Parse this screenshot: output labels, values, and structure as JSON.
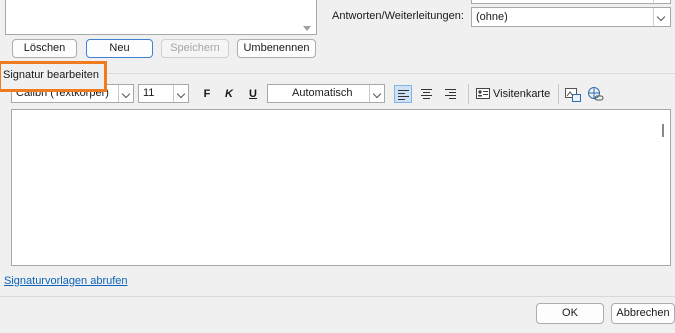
{
  "signature_buttons": {
    "delete": "Löschen",
    "new": "Neu",
    "save": "Speichern",
    "rename": "Umbenennen"
  },
  "replies_forwards": {
    "label": "Antworten/Weiterleitungen:",
    "value": "(ohne)"
  },
  "edit_section": {
    "title": "Signatur bearbeiten"
  },
  "toolbar": {
    "font_family": "Calibri (Textkörper)",
    "font_size": "11",
    "bold": "F",
    "italic": "K",
    "underline": "U",
    "color_value": "Automatisch",
    "business_card": "Visitenkarte"
  },
  "templates_link": "Signaturvorlagen abrufen",
  "dialog_buttons": {
    "ok": "OK",
    "cancel": "Abbrechen"
  },
  "colors": {
    "highlight": "#f07c1f",
    "accent": "#3f7fd5",
    "link": "#0a63b8"
  }
}
